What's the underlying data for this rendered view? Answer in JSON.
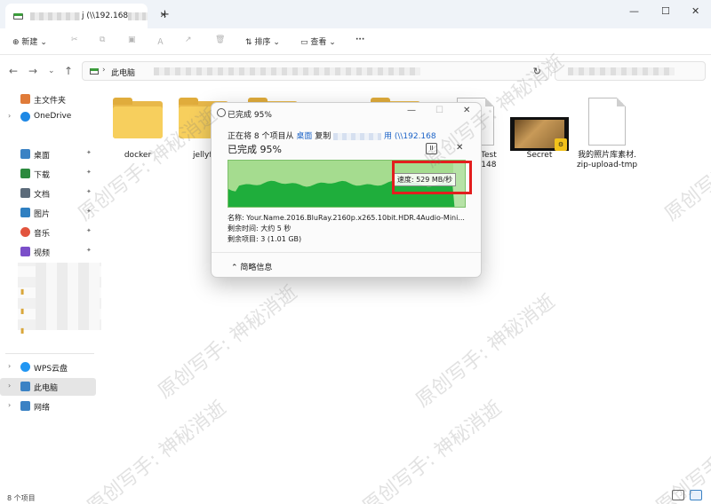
{
  "window": {
    "tab_title_visible": "j (\\\\192.168",
    "new_tab_symbol": "+",
    "minimize": "—",
    "maximize": "☐",
    "close": "✕"
  },
  "toolbar": {
    "new_label": "新建",
    "sort_label": "排序",
    "view_label": "查看",
    "more_label": "···"
  },
  "address": {
    "crumb": "此电脑"
  },
  "sidebar": {
    "items": [
      {
        "label": "主文件夹",
        "chev": "",
        "color": "#e07b39"
      },
      {
        "label": "OneDrive",
        "chev": "›",
        "color": "#1e88e5"
      },
      {
        "label": "桌面",
        "chev": "",
        "color": "#3b82c4",
        "pinned": true
      },
      {
        "label": "下载",
        "chev": "",
        "color": "#2b8a3e",
        "pinned": true
      },
      {
        "label": "文档",
        "chev": "",
        "color": "#5c6b7a",
        "pinned": true
      },
      {
        "label": "图片",
        "chev": "",
        "color": "#2f7fc1",
        "pinned": true
      },
      {
        "label": "音乐",
        "chev": "",
        "color": "#e2543e",
        "pinned": true
      },
      {
        "label": "视频",
        "chev": "",
        "color": "#7b4fc9",
        "pinned": true
      },
      {
        "label": "WPS云盘",
        "chev": "›",
        "color": "#2196f3"
      },
      {
        "label": "此电脑",
        "chev": "›",
        "color": "#3b82c4",
        "selected": true
      },
      {
        "label": "网络",
        "chev": "›",
        "color": "#3b82c4"
      }
    ],
    "pin_symbol": "📌"
  },
  "content": {
    "items": [
      {
        "name": "docker",
        "kind": "folder"
      },
      {
        "name": "jellyfi",
        "kind": "folder"
      },
      {
        "name": "dTest",
        "name2": "5148",
        "kind": "file"
      },
      {
        "name": "Secret",
        "kind": "video"
      },
      {
        "name": "我的照片库素材.",
        "name2": "zip-upload-tmp",
        "kind": "file"
      }
    ]
  },
  "status": {
    "count": "8 个项目"
  },
  "dialog": {
    "title": "已完成 95%",
    "desc_prefix": "正在将 8 个项目从 ",
    "desc_src": "桌面",
    "desc_mid": " 复制",
    "desc_dst": "用 (\\\\192.168",
    "percent_label": "已完成 95%",
    "pause_symbol": "II",
    "close_symbol": "✕",
    "progress_fraction": 0.95,
    "speed": "速度: 529 MB/秒",
    "name_label": "名称: ",
    "name_value": "Your.Name.2016.BluRay.2160p.x265.10bit.HDR.4Audio-Mini...",
    "remaining_time_label": "剩余时间: ",
    "remaining_time_value": "大约 5 秒",
    "remaining_items_label": "剩余项目: ",
    "remaining_items_value": "3 (1.01 GB)",
    "details_toggle": "简略信息",
    "colors": {
      "graph_bg": "#b6e2a6",
      "graph_fill": "#1fae3c",
      "highlight": "#e31e1e"
    }
  },
  "watermark": "原创写手: 神秘消逝"
}
